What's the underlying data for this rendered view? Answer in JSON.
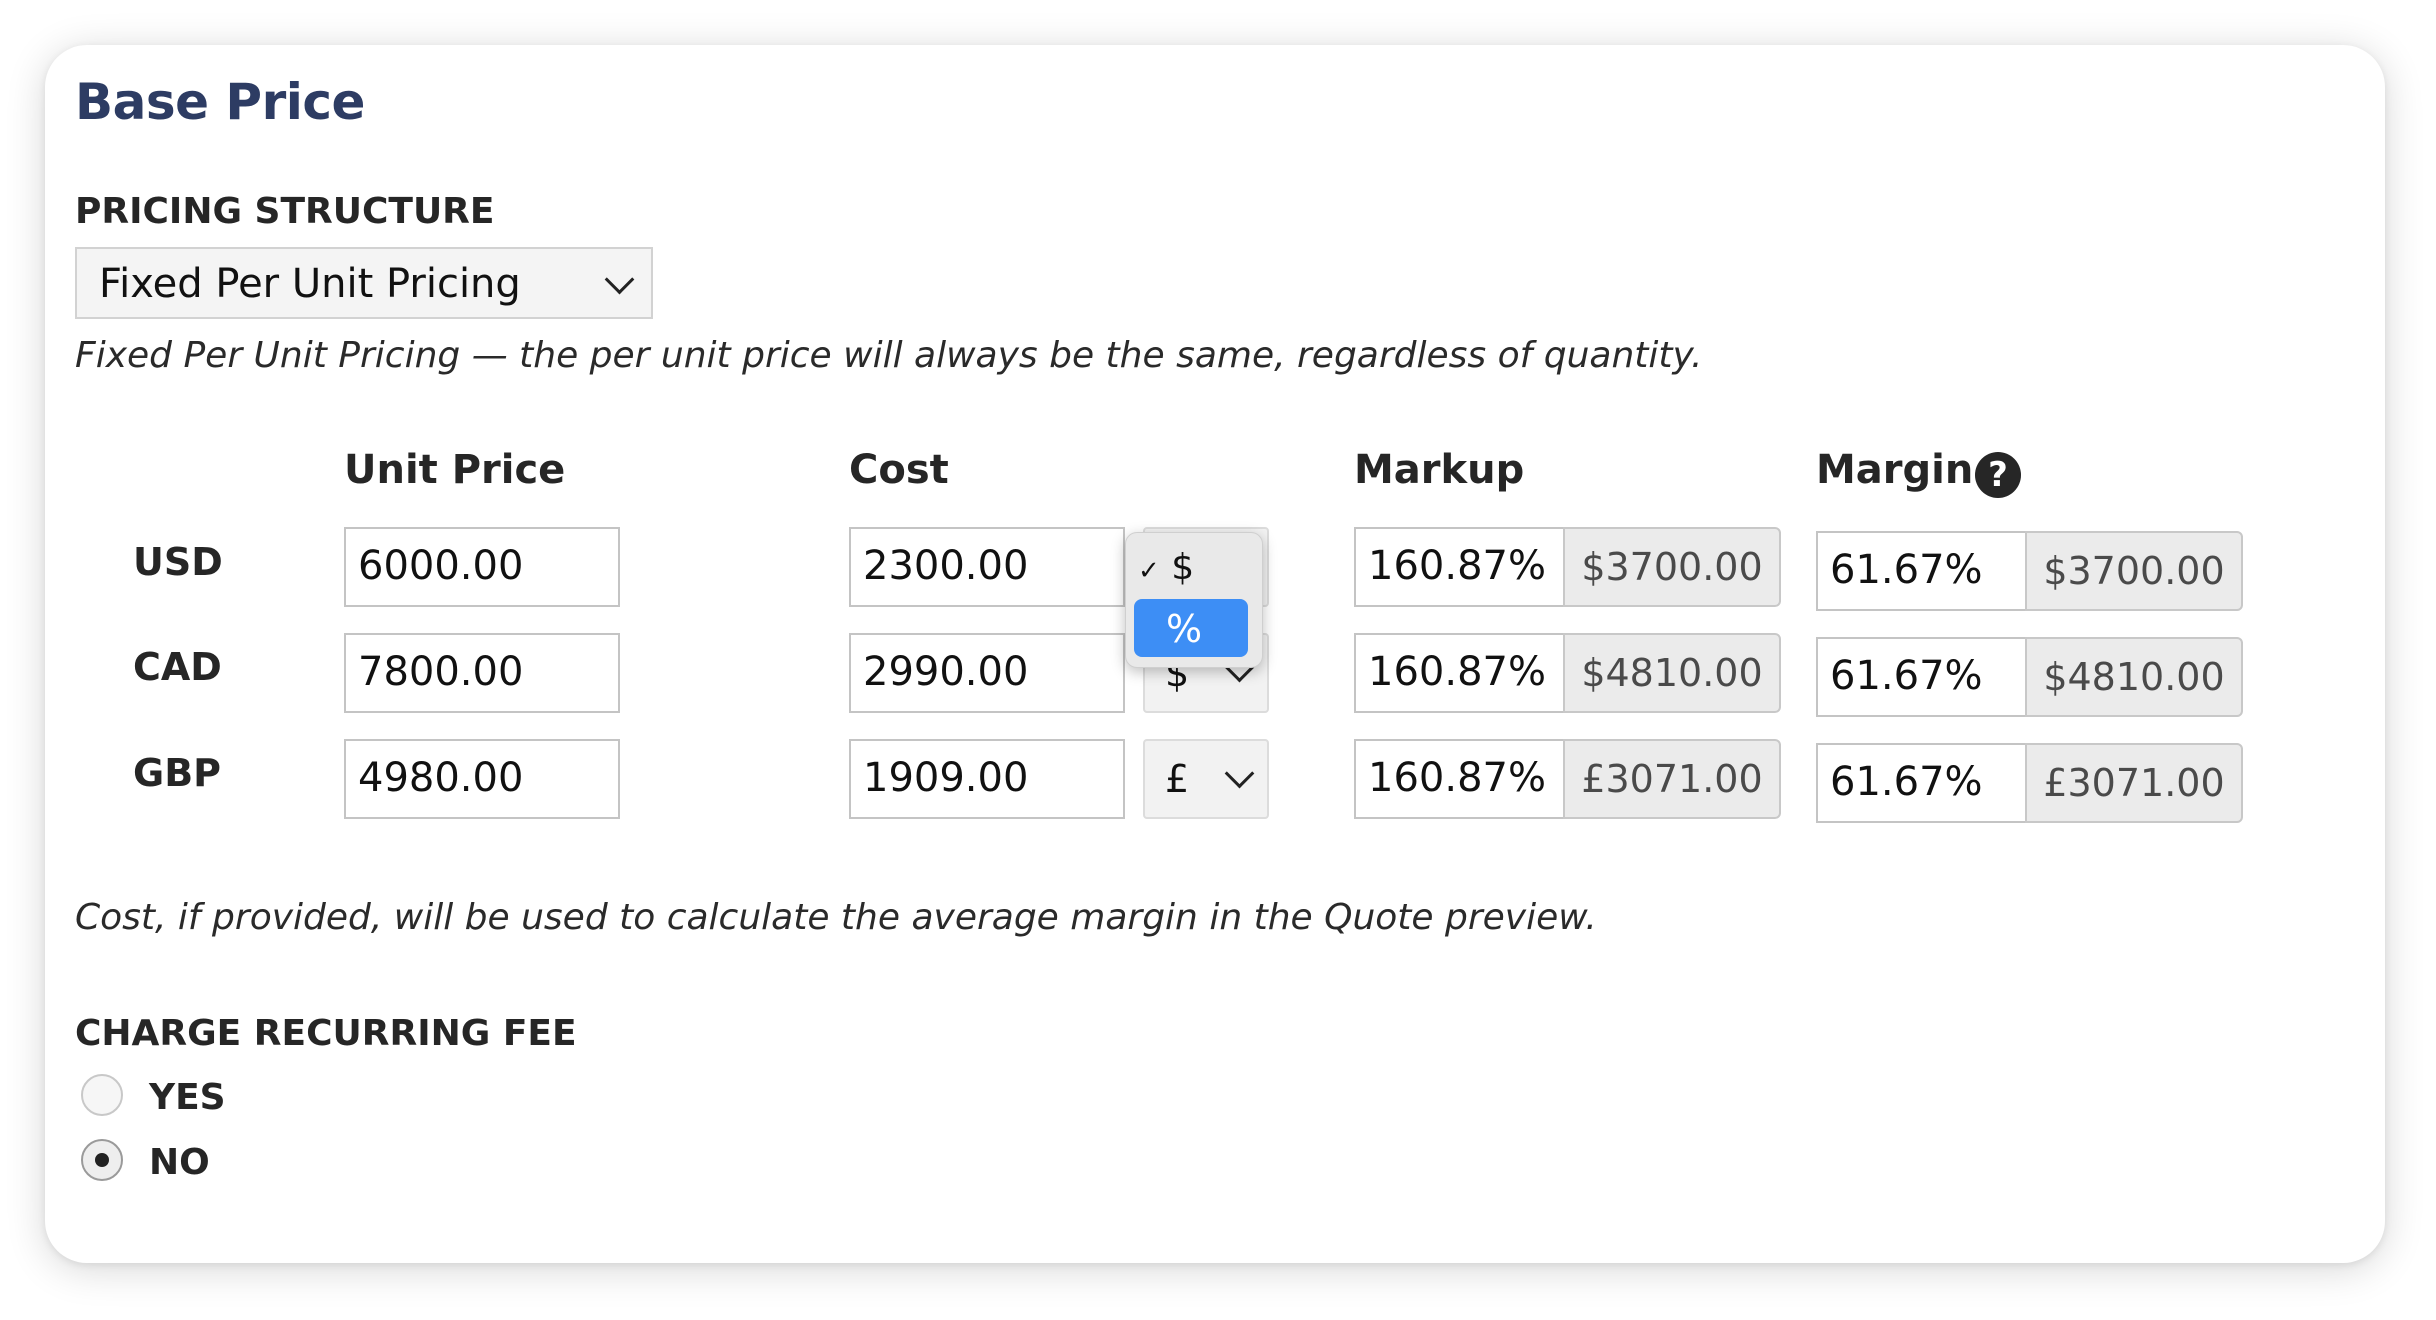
{
  "title": "Base Price",
  "pricing_structure": {
    "label": "PRICING STRUCTURE",
    "selected": "Fixed Per Unit Pricing",
    "description": "Fixed Per Unit Pricing — the per unit price will always be the same, regardless of quantity."
  },
  "columns": {
    "unit_price": "Unit Price",
    "cost": "Cost",
    "markup": "Markup",
    "margin": "Margin"
  },
  "rows": [
    {
      "currency": "USD",
      "unit_price": "6000.00",
      "cost": "2300.00",
      "cost_type": "$",
      "markup_pct": "160.87%",
      "markup_amt": "$3700.00",
      "margin_pct": "61.67%",
      "margin_amt": "$3700.00"
    },
    {
      "currency": "CAD",
      "unit_price": "7800.00",
      "cost": "2990.00",
      "cost_type": "$",
      "markup_pct": "160.87%",
      "markup_amt": "$4810.00",
      "margin_pct": "61.67%",
      "margin_amt": "$4810.00"
    },
    {
      "currency": "GBP",
      "unit_price": "4980.00",
      "cost": "1909.00",
      "cost_type": "£",
      "markup_pct": "160.87%",
      "markup_amt": "£3071.00",
      "margin_pct": "61.67%",
      "margin_amt": "£3071.00"
    }
  ],
  "cost_type_dropdown": {
    "options": [
      {
        "label": "$",
        "checked": true
      },
      {
        "label": "%",
        "highlighted": true
      }
    ]
  },
  "cost_note": "Cost, if provided, will be used to calculate the average margin in the Quote preview.",
  "recurring_fee": {
    "label": "CHARGE RECURRING FEE",
    "options": [
      {
        "label": "YES",
        "checked": false
      },
      {
        "label": "NO",
        "checked": true
      }
    ]
  },
  "icons": {
    "select_chevron": "chevron-down-icon",
    "margin_help": "question-circle-icon",
    "dropdown_check": "checkmark-icon"
  },
  "colors": {
    "title": "#2d3c63",
    "dropdown_highlight": "#3d8ef5"
  }
}
